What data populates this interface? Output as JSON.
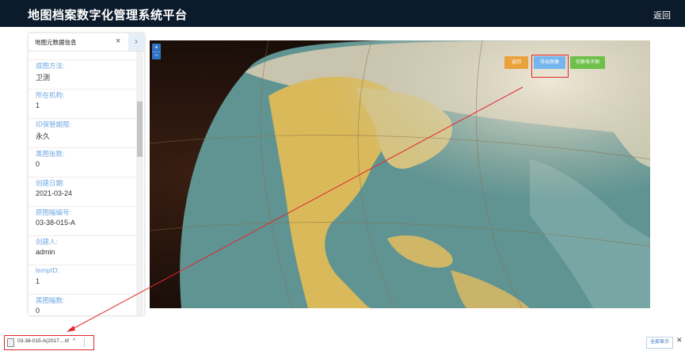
{
  "header": {
    "title": "地图档案数字化管理系统平台",
    "back_label": "返回"
  },
  "panel": {
    "title": "地图元数据信息",
    "close_glyph": "×",
    "toggle_glyph": "›",
    "fields": [
      {
        "label": "",
        "value": ""
      },
      {
        "label": "成图方法:",
        "value": "卫测"
      },
      {
        "label": "所在机构:",
        "value": "1"
      },
      {
        "label": "印保管期限:",
        "value": "永久"
      },
      {
        "label": "黑图张数:",
        "value": "0"
      },
      {
        "label": "创建日期:",
        "value": "2021-03-24"
      },
      {
        "label": "原图幅编号:",
        "value": "03-38-015-A"
      },
      {
        "label": "创建人:",
        "value": "admin"
      },
      {
        "label": "tempID:",
        "value": "1"
      },
      {
        "label": "黑图幅数:",
        "value": "0"
      }
    ]
  },
  "map": {
    "zoom_in": "+",
    "zoom_out": "−",
    "buttons": {
      "back": "返回",
      "export": "导出图像",
      "switch": "切换电子图"
    }
  },
  "download_bar": {
    "filename": "03-38-015-A(2017....tif",
    "caret": "^",
    "show_all": "全部显示",
    "close": "✕"
  },
  "colors": {
    "header_bg": "#0c1b2c",
    "label_blue": "#6fa8e0",
    "highlight_red": "#e3262c"
  }
}
